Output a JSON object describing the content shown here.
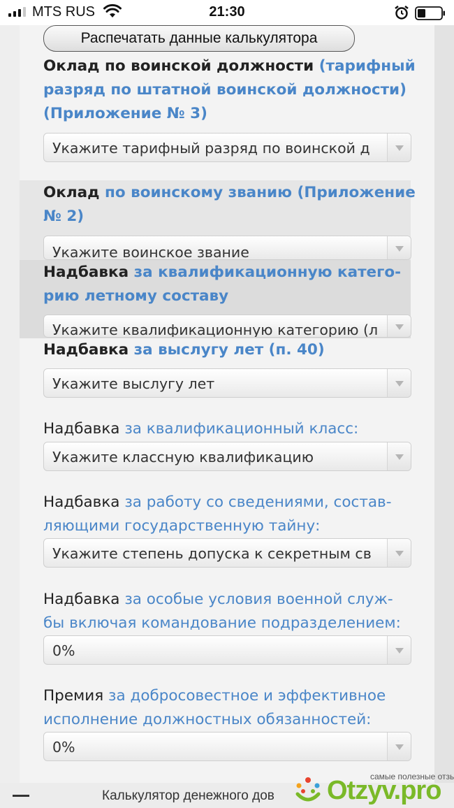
{
  "status_bar": {
    "carrier": "MTS RUS",
    "time": "21:30"
  },
  "form": {
    "print_button": "Распечатать данные калькулятора",
    "fields": [
      {
        "lead": "Оклад по воинской должности",
        "link_line1": "(тарифный",
        "link_line2": "разряд по штатной воинской должности)",
        "link_line3": "(Приложение № 3)",
        "select_value": "Укажите тарифный разряд по воинской д"
      },
      {
        "lead": "Оклад",
        "link_line1": "по воинскому званию (Приложение",
        "link_line2": "№ 2)",
        "select_value": "Укажите воинское звание"
      },
      {
        "lead": "Надбавка",
        "link_line1": "за квалификационную катего-",
        "link_line2": "рию летному составу",
        "select_value": "Укажите квалификационную категорию (л"
      },
      {
        "lead": "Надбавка",
        "link_line1": "за выслугу лет (п. 40)",
        "select_value": "Укажите выслугу лет"
      },
      {
        "lead": "Надбавка",
        "link_line1": "за квалификационный класс:",
        "select_value": "Укажите классную квалификацию"
      },
      {
        "lead": "Надбавка",
        "link_line1": "за работу со сведениями, состав-",
        "link_line2": "ляющими государственную тайну:",
        "select_value": "Укажите степень допуска к секретным св"
      },
      {
        "lead": "Надбавка",
        "link_line1": "за особые условия военной служ-",
        "link_line2": "бы включая командование подразделением:",
        "select_value": "0%"
      },
      {
        "lead": "Премия",
        "link_line1": "за добросовестное и эффективное",
        "link_line2": "исполнение должностных обязанностей:",
        "select_value": "0%"
      }
    ]
  },
  "bottom_bar": {
    "title": "Калькулятор денежного дов"
  },
  "watermark": {
    "tagline": "самые полезные отзывы",
    "brand": "Otzyv.pro"
  },
  "colors": {
    "link": "#4a86c8",
    "brand_green": "#7ab928"
  }
}
